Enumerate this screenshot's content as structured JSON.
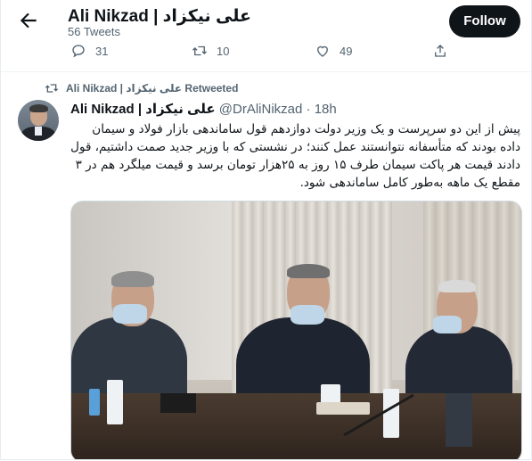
{
  "header": {
    "title": "Ali Nikzad | علی نیکزاد",
    "tweet_count": "56 Tweets",
    "follow_label": "Follow"
  },
  "previous_tweet_actions": {
    "replies": "31",
    "retweets": "10",
    "likes": "49"
  },
  "tweet": {
    "retweet_context": "Ali Nikzad | علی نیکزاد Retweeted",
    "author_name": "Ali Nikzad | علی نیکزاد",
    "handle": "@DrAliNikzad",
    "separator": "·",
    "time": "18h",
    "text": "پیش از این دو سرپرست و یک وزیر دولت دوازدهم قول ساماندهی بازار فولاد و سیمان داده بودند که متأسفانه نتوانستند عمل کنند؛ در نشستی که با وزیر جدید صمت داشتیم، قول دادند قیمت هر پاکت سیمان طرف ۱۵ روز به ۲۵هزار تومان برسد و قیمت میلگرد هم در ۳ مقطع یک ماهه به‌طور کامل ساماندهی شود."
  },
  "colors": {
    "follow_bg": "#0f1419",
    "secondary_text": "#536471",
    "border": "#cfd9de"
  },
  "icons": [
    "back-arrow-icon",
    "reply-icon",
    "retweet-icon",
    "like-icon",
    "share-icon"
  ]
}
